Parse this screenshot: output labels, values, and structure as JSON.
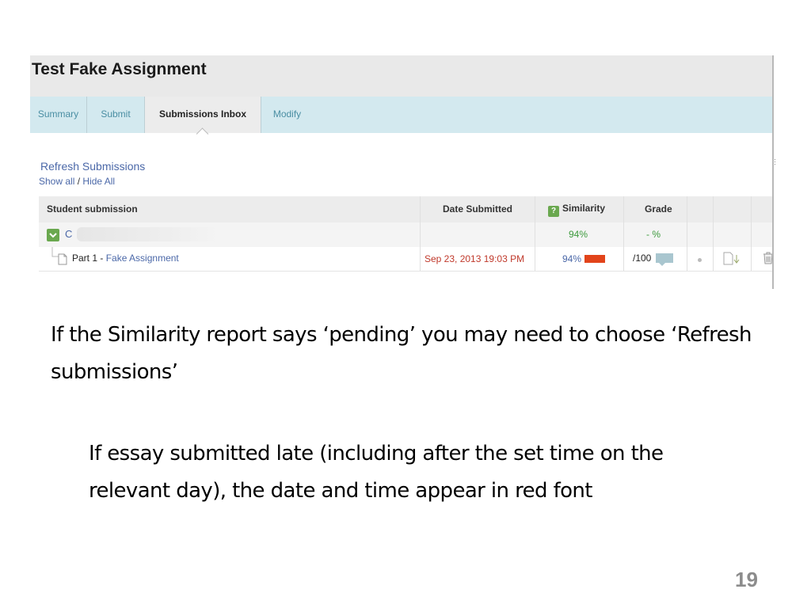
{
  "assignment": {
    "title": "Test Fake Assignment",
    "tabs": [
      {
        "label": "Summary",
        "active": false
      },
      {
        "label": "Submit",
        "active": false
      },
      {
        "label": "Submissions Inbox",
        "active": true
      },
      {
        "label": "Modify",
        "active": false
      }
    ],
    "refresh_label": "Refresh Submissions",
    "show_all_label": "Show all",
    "separator": "/",
    "hide_all_label": "Hide All",
    "table": {
      "headers": {
        "student": "Student submission",
        "date": "Date Submitted",
        "similarity_icon": "?",
        "similarity": "Similarity",
        "grade": "Grade"
      },
      "student_row": {
        "name_initial": "C",
        "similarity": "94%",
        "grade": "- %"
      },
      "part_row": {
        "part_label": "Part 1 -",
        "assignment_link": "Fake Assignment",
        "date_submitted": "Sep 23, 2013 19:03 PM",
        "similarity": "94%",
        "grade": "/100"
      }
    },
    "colors": {
      "late_date": "#c0392b",
      "similarity_bar": "#e2441a",
      "similarity_green": "#3d9a3d",
      "link_blue": "#4b68a8"
    }
  },
  "slide": {
    "paragraph1": "If the Similarity report says ‘pending’ you may need to choose ‘Refresh submissions’",
    "paragraph2": "If essay submitted late (including after the set time on the relevant day), the date and time appear in red font",
    "page_number": "19"
  }
}
